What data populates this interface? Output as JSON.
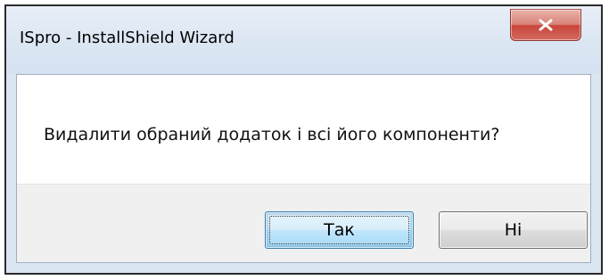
{
  "window": {
    "title": "ISpro - InstallShield Wizard"
  },
  "dialog": {
    "message": "Видалити обраний додаток і всі його компоненти?"
  },
  "buttons": {
    "yes_label": "Так",
    "no_label": "Ні"
  },
  "icons": {
    "close": "close-icon"
  },
  "colors": {
    "close_button": "#c9453b",
    "default_button_border": "#3c7fb1",
    "button_band": "#f0f0f0",
    "frame": "#dbe6f3"
  }
}
